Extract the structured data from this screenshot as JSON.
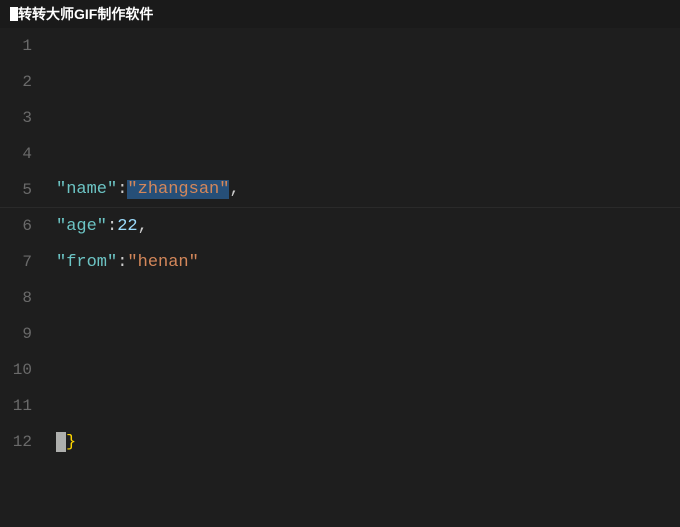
{
  "title": {
    "text": "转转大师GIF制作软件"
  },
  "editor": {
    "lines": [
      {
        "number": "1",
        "content": null
      },
      {
        "number": "2",
        "content": null
      },
      {
        "number": "3",
        "content": null
      },
      {
        "number": "4",
        "content": null
      },
      {
        "number": "5",
        "content": "name_zhangsan",
        "type": "name-line"
      },
      {
        "number": "6",
        "content": "age_22",
        "type": "age-line"
      },
      {
        "number": "7",
        "content": "from_henan",
        "type": "from-line"
      },
      {
        "number": "8",
        "content": null
      },
      {
        "number": "9",
        "content": null
      },
      {
        "number": "10",
        "content": null
      },
      {
        "number": "11",
        "content": null
      },
      {
        "number": "12",
        "content": "brace",
        "type": "brace-line"
      }
    ],
    "keys": {
      "name": "\"name\"",
      "age": "\"age\"",
      "from": "\"from\""
    },
    "values": {
      "zhangsan": "\"zhangsan\"",
      "age_val": "22",
      "henan": "\"henan\""
    }
  }
}
